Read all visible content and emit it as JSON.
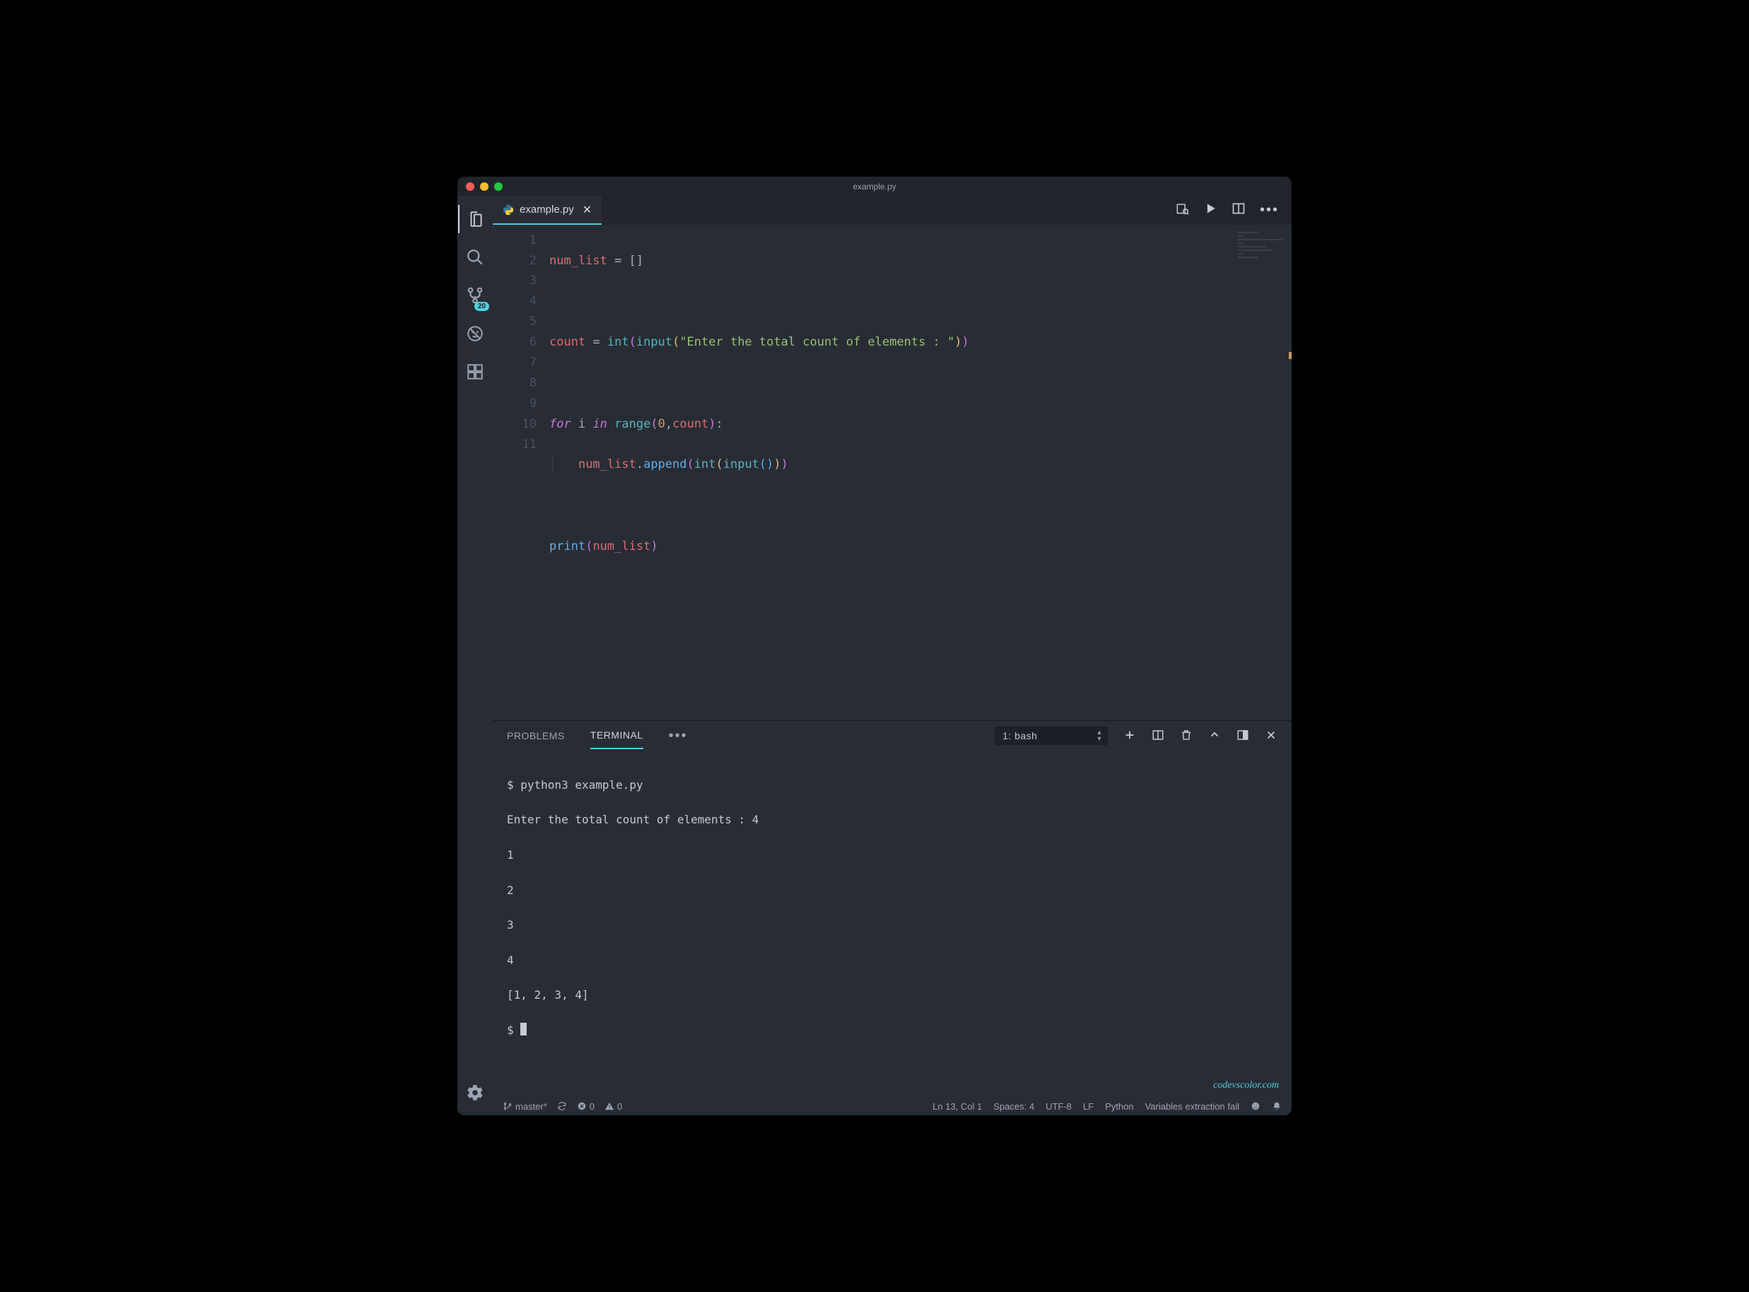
{
  "window": {
    "title": "example.py"
  },
  "activitybar": {
    "scm_badge": "20"
  },
  "tab": {
    "filename": "example.py"
  },
  "editor": {
    "line_numbers": [
      "1",
      "2",
      "3",
      "4",
      "5",
      "6",
      "7",
      "8",
      "9",
      "10",
      "11"
    ],
    "code": {
      "l1_var": "num_list",
      "l1_rest": " = []",
      "l3_var": "count",
      "l3_eq": " = ",
      "l3_int": "int",
      "l3_input": "input",
      "l3_str": "\"Enter the total count of elements : \"",
      "l5_for": "for",
      "l5_i": " i ",
      "l5_in": "in",
      "l5_range": "range",
      "l5_zero": "0",
      "l5_count2": "count",
      "l6_var": "num_list",
      "l6_append": "append",
      "l6_int2": "int",
      "l6_input2": "input",
      "l8_print": "print",
      "l8_var": "num_list"
    }
  },
  "panel": {
    "tabs": {
      "problems": "PROBLEMS",
      "terminal": "TERMINAL"
    },
    "select": "1: bash",
    "terminal_lines": [
      "$ python3 example.py",
      "Enter the total count of elements : 4",
      "1",
      "2",
      "3",
      "4",
      "[1, 2, 3, 4]"
    ],
    "prompt": "$ "
  },
  "watermark": "codevscolor.com",
  "statusbar": {
    "branch": "master*",
    "errors": "0",
    "warnings": "0",
    "position": "Ln 13, Col 1",
    "spaces": "Spaces: 4",
    "encoding": "UTF-8",
    "eol": "LF",
    "language": "Python",
    "diag": "Variables extraction fail"
  }
}
